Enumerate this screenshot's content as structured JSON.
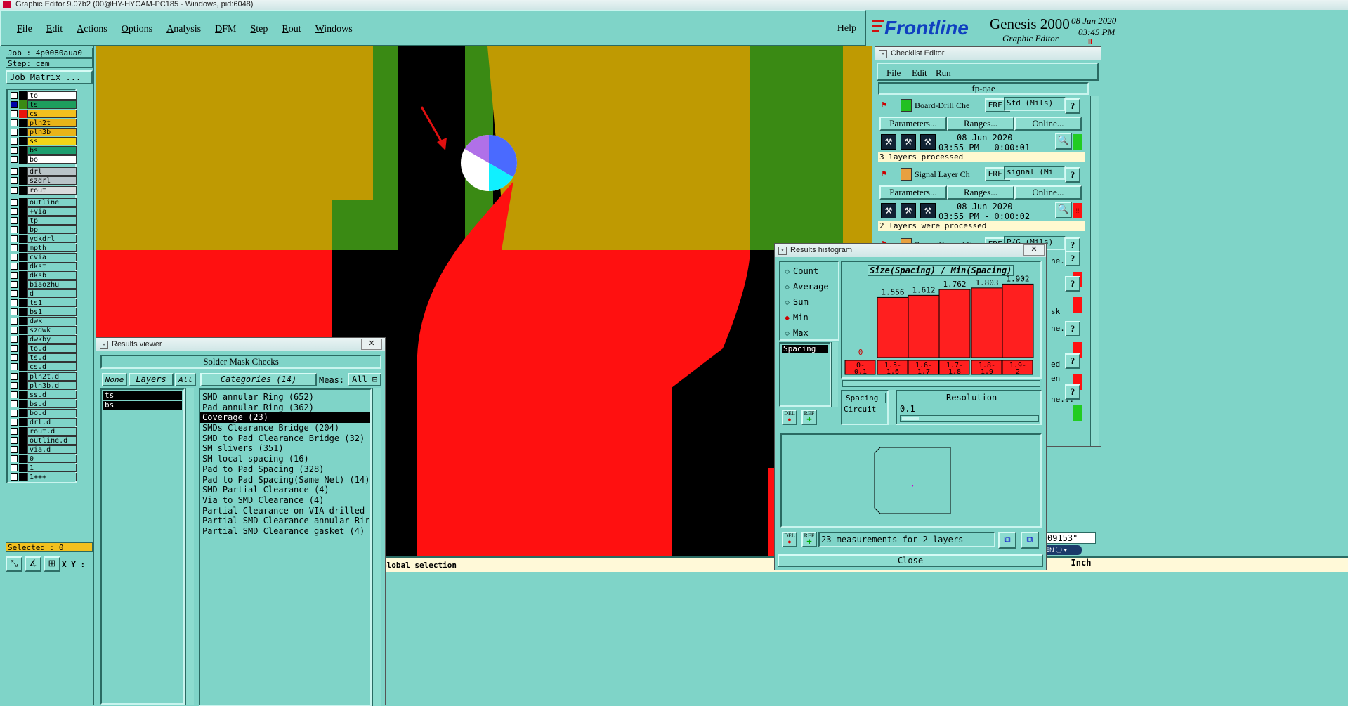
{
  "title_bar": {
    "text": "Graphic Editor 9.07b2 (00@HY-HYCAM-PC185 - Windows, pid:6048)"
  },
  "menu": {
    "items": [
      "File",
      "Edit",
      "Actions",
      "Options",
      "Analysis",
      "DFM",
      "Step",
      "Rout",
      "Windows"
    ],
    "help": "Help"
  },
  "brand": {
    "logo": "Frontline",
    "product": "Genesis 2000",
    "subtitle": "Graphic Editor",
    "date": "08 Jun 2020",
    "time": "03:45 PM"
  },
  "job": {
    "job_label": "Job : 4p0080aua0",
    "step_label": "Step: cam",
    "matrix_button": "Job Matrix ..."
  },
  "layers": [
    {
      "name": "to",
      "color": "#ffffff",
      "sw": "#000000"
    },
    {
      "name": "ts",
      "color": "#1e9e5e",
      "sw": "#3a8a14"
    },
    {
      "name": "cs",
      "color": "#f2c01e",
      "sw": "#e8140c"
    },
    {
      "name": "pln2t",
      "color": "#e8b418",
      "sw": "#000000"
    },
    {
      "name": "pln3b",
      "color": "#e8b418",
      "sw": "#000000"
    },
    {
      "name": "ss",
      "color": "#f2d418",
      "sw": "#000000"
    },
    {
      "name": "bs",
      "color": "#1e9e6e",
      "sw": "#000000"
    },
    {
      "name": "bo",
      "color": "#ffffff",
      "sw": "#000000"
    },
    {
      "name": "drl",
      "color": "#b9c4c8",
      "sw": "#000000"
    },
    {
      "name": "szdrl",
      "color": "#b9c4c8",
      "sw": "#000000"
    },
    {
      "name": "rout",
      "color": "#d8dcdc",
      "sw": "#000000"
    },
    {
      "name": "outline",
      "color": "#7fd4c8",
      "sw": "#000000"
    },
    {
      "name": "+via",
      "color": "#7fd4c8",
      "sw": "#000000"
    },
    {
      "name": "tp",
      "color": "#7fd4c8",
      "sw": "#000000"
    },
    {
      "name": "bp",
      "color": "#7fd4c8",
      "sw": "#000000"
    },
    {
      "name": "ydkdrl",
      "color": "#7fd4c8",
      "sw": "#000000"
    },
    {
      "name": "mpth",
      "color": "#7fd4c8",
      "sw": "#000000"
    },
    {
      "name": "cvia",
      "color": "#7fd4c8",
      "sw": "#000000"
    },
    {
      "name": "dkst",
      "color": "#7fd4c8",
      "sw": "#000000"
    },
    {
      "name": "dksb",
      "color": "#7fd4c8",
      "sw": "#000000"
    },
    {
      "name": "biaozhu",
      "color": "#7fd4c8",
      "sw": "#000000"
    },
    {
      "name": "d",
      "color": "#7fd4c8",
      "sw": "#000000"
    },
    {
      "name": "ts1",
      "color": "#7fd4c8",
      "sw": "#000000"
    },
    {
      "name": "bs1",
      "color": "#7fd4c8",
      "sw": "#000000"
    },
    {
      "name": "dwk",
      "color": "#7fd4c8",
      "sw": "#000000"
    },
    {
      "name": "szdwk",
      "color": "#7fd4c8",
      "sw": "#000000"
    },
    {
      "name": "dwkby",
      "color": "#7fd4c8",
      "sw": "#000000"
    },
    {
      "name": "to.d",
      "color": "#7fd4c8",
      "sw": "#000000"
    },
    {
      "name": "ts.d",
      "color": "#7fd4c8",
      "sw": "#000000"
    },
    {
      "name": "cs.d",
      "color": "#7fd4c8",
      "sw": "#000000"
    },
    {
      "name": "pln2t.d",
      "color": "#7fd4c8",
      "sw": "#000000"
    },
    {
      "name": "pln3b.d",
      "color": "#7fd4c8",
      "sw": "#000000"
    },
    {
      "name": "ss.d",
      "color": "#7fd4c8",
      "sw": "#000000"
    },
    {
      "name": "bs.d",
      "color": "#7fd4c8",
      "sw": "#000000"
    },
    {
      "name": "bo.d",
      "color": "#7fd4c8",
      "sw": "#000000"
    },
    {
      "name": "drl.d",
      "color": "#7fd4c8",
      "sw": "#000000"
    },
    {
      "name": "rout.d",
      "color": "#7fd4c8",
      "sw": "#000000"
    },
    {
      "name": "outline.d",
      "color": "#7fd4c8",
      "sw": "#000000"
    },
    {
      "name": "via.d",
      "color": "#7fd4c8",
      "sw": "#000000"
    },
    {
      "name": "0",
      "color": "#7fd4c8",
      "sw": "#000000"
    },
    {
      "name": "1",
      "color": "#7fd4c8",
      "sw": "#000000"
    },
    {
      "name": "1+++",
      "color": "#7fd4c8",
      "sw": "#000000"
    }
  ],
  "selected": "Selected : 0",
  "xy_label": "X Y :",
  "status": {
    "message": "Global selection",
    "units": "Inch",
    "coord": "09153\""
  },
  "results_viewer": {
    "title": "Results viewer",
    "header": "Solder Mask Checks",
    "none_btn": "None",
    "layers_btn": "Layers",
    "all_btn": "All",
    "categories_btn": "Categories (14)",
    "meas_label": "Meas:",
    "meas_value": "All",
    "layers": [
      "ts",
      "bs"
    ],
    "categories": [
      "SMD annular Ring (652)",
      "Pad annular Ring (362)",
      "Coverage (23)",
      "SMDs Clearance Bridge (204)",
      "SMD to Pad Clearance Bridge (32)",
      "SM slivers (351)",
      "SM local spacing (16)",
      "Pad to Pad Spacing (328)",
      "Pad to Pad Spacing(Same Net) (14)",
      "SMD Partial Clearance (4)",
      "Via to SMD Clearance (4)",
      "Partial Clearance on VIA drilled",
      "Partial SMD Clearance annular Rir",
      "Partial SMD Clearance gasket (4)"
    ],
    "selected_index": 2
  },
  "checklist": {
    "title": "Checklist Editor",
    "menu": [
      "File",
      "Edit",
      "Run"
    ],
    "name": "fp-qae",
    "blocks": [
      {
        "name": "Board-Drill Che",
        "erf": "ERF:",
        "erf_value": "Std (Mils)",
        "params": "Parameters...",
        "ranges": "Ranges...",
        "online": "Online...",
        "date": "08 Jun 2020",
        "time": "03:55 PM - 0:00:01",
        "msg": "3 layers processed",
        "status_color": "#22cc22"
      },
      {
        "name": "Signal Layer Ch",
        "erf": "ERF:",
        "erf_value": "signal (Mi",
        "params": "Parameters...",
        "ranges": "Ranges...",
        "online": "Online...",
        "date": "08 Jun 2020",
        "time": "03:55 PM - 0:00:02",
        "msg": "2 layers were processed",
        "status_color": "#ff1111"
      },
      {
        "name": "Power/Ground C",
        "erf": "ERF:",
        "erf_value": "P/G (Mils)"
      }
    ],
    "partials": [
      "ne...",
      "sk",
      "ne...",
      "ed",
      "en",
      "ne..."
    ]
  },
  "histogram": {
    "title": "Results histogram",
    "modes": [
      "Count",
      "Average",
      "Sum",
      "Min",
      "Max"
    ],
    "selected_mode": "Min",
    "measure": "Spacing",
    "chart_title": "Size(Spacing) / Min(Spacing)",
    "meas_list": [
      "Spacing",
      "Circuit"
    ],
    "resolution_label": "Resolution",
    "resolution_value": "0.1",
    "footer": "23 measurements for 2 layers",
    "close": "Close",
    "del": "DEL",
    "ref": "REF"
  },
  "chart_data": {
    "type": "bar",
    "title": "Size(Spacing) / Min(Spacing)",
    "categories": [
      "0-0.1",
      "1.5-1.6",
      "1.6-1.7",
      "1.7-1.8",
      "1.8-1.9",
      "1.9-2"
    ],
    "values": [
      0,
      1.556,
      1.612,
      1.762,
      1.803,
      1.902
    ],
    "labels": [
      "0",
      "1.556",
      "1.612",
      "1.762",
      "1.803",
      "1.902"
    ],
    "bar_color": "#ff1f1f"
  },
  "tray": {
    "lang": "EN"
  }
}
